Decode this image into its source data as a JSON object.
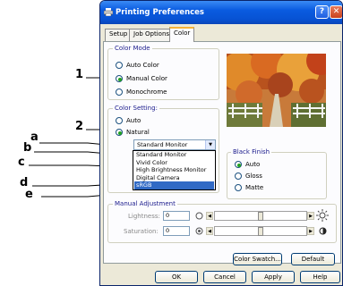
{
  "window": {
    "title": "Printing Preferences",
    "help_btn": "?",
    "close_btn": "✕"
  },
  "tabs": [
    "Setup",
    "Job Options",
    "Color"
  ],
  "color_mode": {
    "label": "Color Mode",
    "options": [
      "Auto Color",
      "Manual Color",
      "Monochrome"
    ],
    "selected": "Manual Color"
  },
  "color_setting": {
    "label": "Color Setting:",
    "options": [
      "Auto",
      "Natural"
    ],
    "selected": "Natural",
    "combo_value": "Standard Monitor",
    "dropdown_items": [
      "Standard Monitor",
      "Vivid Color",
      "High Brightness Monitor",
      "Digital Camera",
      "sRGB"
    ],
    "highlighted_item": "sRGB"
  },
  "black_finish": {
    "label": "Black Finish",
    "options": [
      "Auto",
      "Gloss",
      "Matte"
    ],
    "selected": "Auto"
  },
  "manual_adjustment": {
    "label": "Manual Adjustment",
    "lightness_label": "Lightness:",
    "lightness_value": "0",
    "saturation_label": "Saturation:",
    "saturation_value": "0"
  },
  "panel_buttons": {
    "swatch": "Color Swatch...",
    "default": "Default"
  },
  "dialog_buttons": {
    "ok": "OK",
    "cancel": "Cancel",
    "apply": "Apply",
    "help": "Help"
  },
  "callouts": [
    "1",
    "2",
    "a",
    "b",
    "c",
    "d",
    "e"
  ],
  "icons": {
    "printer": "printer-icon",
    "brightness": "sun-icon",
    "saturation": "half-circle-icon",
    "contrast_left": "circle-icon",
    "saturation_left": "target-icon"
  }
}
